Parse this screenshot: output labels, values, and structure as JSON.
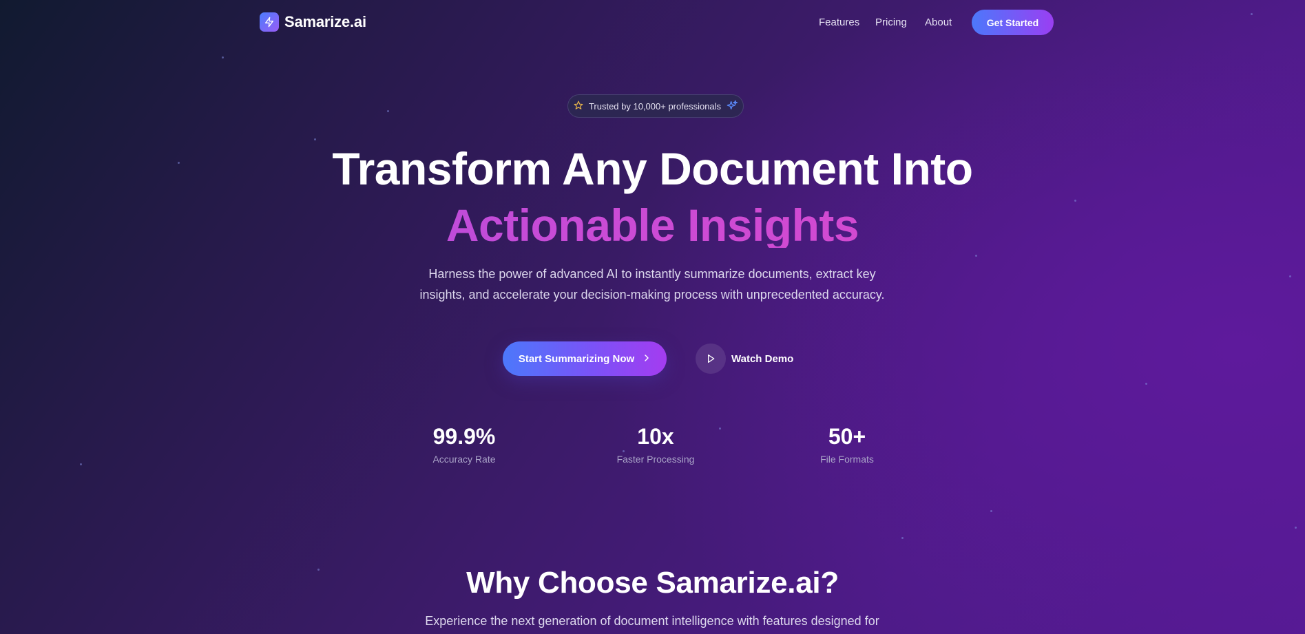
{
  "nav": {
    "brand": "Samarize.ai",
    "links": [
      "Features",
      "Pricing",
      "About"
    ],
    "cta": "Get Started"
  },
  "hero": {
    "badge": "Trusted by 10,000+ professionals",
    "title_line1": "Transform Any Document Into",
    "title_line2": "Actionable Insights",
    "subtitle": "Harness the power of advanced AI to instantly summarize documents, extract key insights, and accelerate your decision-making process with unprecedented accuracy.",
    "primary_cta": "Start Summarizing Now",
    "secondary_cta": "Watch Demo"
  },
  "stats": [
    {
      "value": "99.9%",
      "label": "Accuracy Rate"
    },
    {
      "value": "10x",
      "label": "Faster Processing"
    },
    {
      "value": "50+",
      "label": "File Formats"
    }
  ],
  "features_section": {
    "title": "Why Choose Samarize.ai?",
    "subtitle": "Experience the next generation of document intelligence with features designed for"
  },
  "icons": {
    "logo": "lightning-bolt-icon",
    "badge_left": "star-icon",
    "badge_right": "sparkles-icon",
    "primary_cta": "chevron-right-icon",
    "demo": "play-icon"
  },
  "colors": {
    "accent_start": "#4c78fb",
    "accent_end": "#a43cf0",
    "headline_gradient_start": "#a24de3",
    "headline_gradient_end": "#e149c9"
  }
}
